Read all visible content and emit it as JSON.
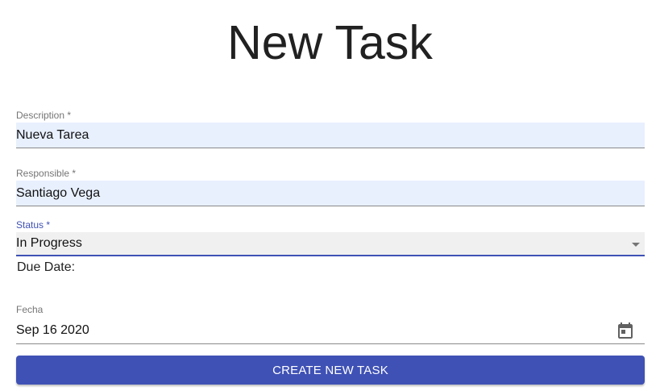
{
  "page": {
    "title": "New Task"
  },
  "form": {
    "description": {
      "label": "Description *",
      "value": "Nueva Tarea"
    },
    "responsible": {
      "label": "Responsible *",
      "value": "Santiago Vega"
    },
    "status": {
      "label": "Status *",
      "value": "In Progress"
    },
    "due_date_label": "Due Date:",
    "fecha": {
      "label": "Fecha",
      "value": "Sep 16 2020",
      "icon": "calendar-icon"
    },
    "submit_label": "CREATE NEW TASK"
  },
  "colors": {
    "primary": "#3f51b5",
    "autofill_background": "#e8f0fe",
    "select_background": "#f0f0f0"
  }
}
